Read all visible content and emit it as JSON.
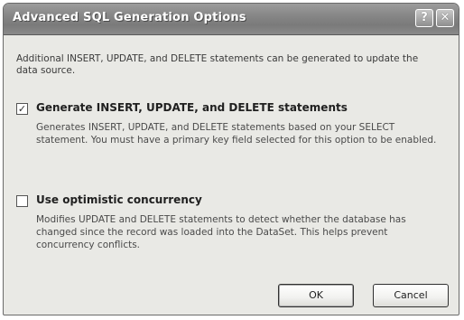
{
  "window": {
    "title": "Advanced SQL Generation Options",
    "help_glyph": "?",
    "close_glyph": "✕"
  },
  "intro": "Additional INSERT, UPDATE, and DELETE statements can be generated to update the data source.",
  "options": [
    {
      "label": "Generate INSERT, UPDATE, and DELETE statements",
      "checked": true,
      "check_glyph": "✓",
      "description": "Generates INSERT, UPDATE, and DELETE statements based on your SELECT statement. You must have a primary key field selected for this option to be enabled."
    },
    {
      "label": "Use optimistic concurrency",
      "checked": false,
      "check_glyph": "",
      "description": "Modifies UPDATE and DELETE statements to detect whether the database has changed since the record was loaded into the DataSet. This helps prevent concurrency conflicts."
    }
  ],
  "buttons": {
    "ok": "OK",
    "cancel": "Cancel"
  }
}
